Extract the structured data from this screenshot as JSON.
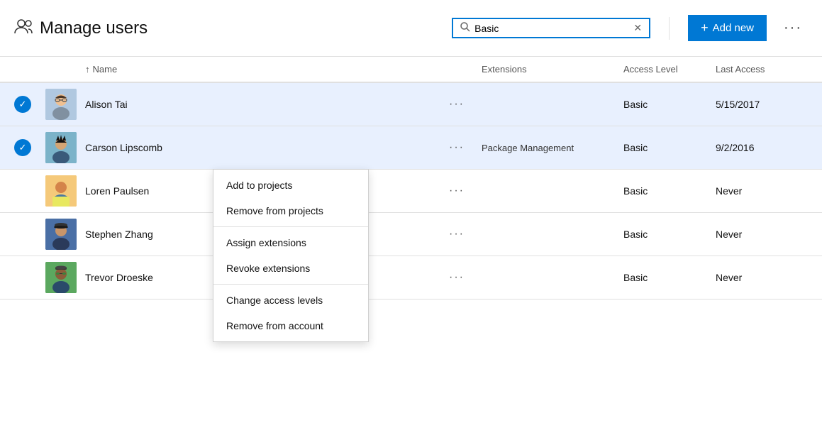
{
  "header": {
    "title": "Manage users",
    "search_placeholder": "Basic",
    "search_value": "Basic",
    "add_new_label": "Add new",
    "more_icon": "···"
  },
  "table": {
    "columns": {
      "name": "Name",
      "extensions": "Extensions",
      "access_level": "Access Level",
      "last_access": "Last Access"
    },
    "rows": [
      {
        "id": "alison-tai",
        "name": "Alison Tai",
        "selected": true,
        "avatar": "alison",
        "extensions": "",
        "access_level": "Basic",
        "last_access": "5/15/2017"
      },
      {
        "id": "carson-lipscomb",
        "name": "Carson Lipscomb",
        "selected": true,
        "avatar": "carson",
        "extensions": "Package Management",
        "access_level": "Basic",
        "last_access": "9/2/2016"
      },
      {
        "id": "loren-paulsen",
        "name": "Loren Paulsen",
        "selected": false,
        "avatar": "loren",
        "extensions": "",
        "access_level": "Basic",
        "last_access": "Never"
      },
      {
        "id": "stephen-zhang",
        "name": "Stephen Zhang",
        "selected": false,
        "avatar": "stephen",
        "extensions": "",
        "access_level": "Basic",
        "last_access": "Never"
      },
      {
        "id": "trevor-droeske",
        "name": "Trevor Droeske",
        "selected": false,
        "avatar": "trevor",
        "extensions": "",
        "access_level": "Basic",
        "last_access": "Never"
      }
    ]
  },
  "context_menu": {
    "items": [
      {
        "id": "add-to-projects",
        "label": "Add to projects"
      },
      {
        "id": "remove-from-projects",
        "label": "Remove from projects"
      },
      {
        "id": "assign-extensions",
        "label": "Assign extensions"
      },
      {
        "id": "revoke-extensions",
        "label": "Revoke extensions"
      },
      {
        "id": "change-access-levels",
        "label": "Change access levels"
      },
      {
        "id": "remove-from-account",
        "label": "Remove from account"
      }
    ]
  }
}
